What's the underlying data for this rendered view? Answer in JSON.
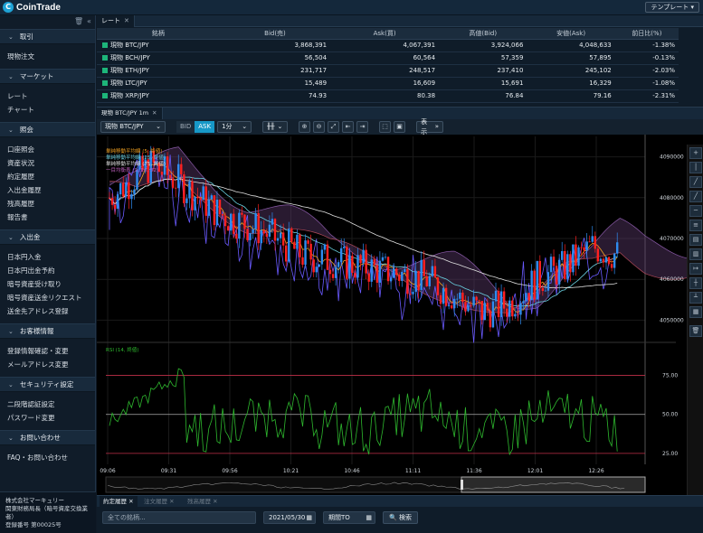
{
  "app": {
    "logo_text": "CoinTrade",
    "template_label": "テンプレート ▾"
  },
  "sidebar": {
    "sections": [
      {
        "label": "取引",
        "items": [
          "現物注文"
        ]
      },
      {
        "label": "マーケット",
        "items": [
          "レート",
          "チャート"
        ]
      },
      {
        "label": "照会",
        "items": [
          "口座照会",
          "資産状況",
          "約定履歴",
          "入出金履歴",
          "残高履歴",
          "報告書"
        ]
      },
      {
        "label": "入出金",
        "items": [
          "日本円入金",
          "日本円出金予約",
          "暗号資産受け取り",
          "暗号資産送金リクエスト",
          "送金先アドレス登録"
        ]
      },
      {
        "label": "お客様情報",
        "items": [
          "登録情報確認・変更",
          "メールアドレス変更"
        ]
      },
      {
        "label": "セキュリティ設定",
        "items": [
          "二段階認証設定",
          "パスワード変更"
        ]
      },
      {
        "label": "お問い合わせ",
        "items": [
          "FAQ・お問い合わせ"
        ]
      }
    ],
    "company": [
      "株式会社マーキュリー",
      "関東財務局長（暗号資産交換業者）",
      "登録番号 第00025号"
    ]
  },
  "rates": {
    "tab_label": "レート",
    "columns": [
      "銘柄",
      "Bid(売)",
      "Ask(買)",
      "高値(Bid)",
      "安値(Ask)",
      "前日比(%)"
    ],
    "rows": [
      {
        "symbol": "現物 BTC/JPY",
        "bid": "3,868,391",
        "ask": "4,067,391",
        "high": "3,924,066",
        "low": "4,048,633",
        "change": "-1.38%"
      },
      {
        "symbol": "現物 BCH/JPY",
        "bid": "56,504",
        "ask": "60,564",
        "high": "57,359",
        "low": "57,895",
        "change": "-0.13%"
      },
      {
        "symbol": "現物 ETH/JPY",
        "bid": "231,717",
        "ask": "248,517",
        "high": "237,410",
        "low": "245,102",
        "change": "-2.03%"
      },
      {
        "symbol": "現物 LTC/JPY",
        "bid": "15,489",
        "ask": "16,609",
        "high": "15,691",
        "low": "16,329",
        "change": "-1.08%"
      },
      {
        "symbol": "現物 XRP/JPY",
        "bid": "74.93",
        "ask": "80.38",
        "high": "76.84",
        "low": "79.16",
        "change": "-2.31%"
      }
    ]
  },
  "chart": {
    "tab_label": "現物 BTC/JPY 1m",
    "symbol": "現物 BTC/JPY",
    "bid_label": "BID",
    "ask_label": "ASK",
    "interval": "1分",
    "display_label": "表示",
    "legend": [
      "単純移動平均線 (5, 終値)",
      "単純移動平均線 (25, 終値)",
      "単純移動平均線 (75, 終値)",
      "一目均衡表 (9, 26, 52)"
    ],
    "legend_colors": [
      "#f0a020",
      "#6ad0e0",
      "#e0e0e0",
      "#c060c0"
    ],
    "rsi_label": "RSI (14, 終値)"
  },
  "chart_data": [
    {
      "type": "candlestick",
      "title": "現物 BTC/JPY 1m",
      "x_ticks": [
        "09:06",
        "09:31",
        "09:56",
        "10:21",
        "10:46",
        "11:11",
        "11:36",
        "12:01",
        "12:26"
      ],
      "y_ticks": [
        4050000,
        4060000,
        4070000,
        4080000,
        4090000
      ],
      "ylim": [
        4045000,
        4095000
      ],
      "up_color": "#2f8cf0",
      "down_color": "#ff2020"
    },
    {
      "type": "line",
      "title": "RSI (14, 終値)",
      "y_ticks": [
        25,
        50,
        75
      ],
      "ylim": [
        18,
        95
      ],
      "bands": [
        25,
        50,
        75
      ]
    }
  ],
  "bottom": {
    "tabs": [
      "約定履歴",
      "注文履歴",
      "残高履歴"
    ],
    "brand_placeholder": "全ての銘柄...",
    "date_from": "2021/05/30",
    "date_to": "期間TO",
    "search_label": "検索"
  }
}
